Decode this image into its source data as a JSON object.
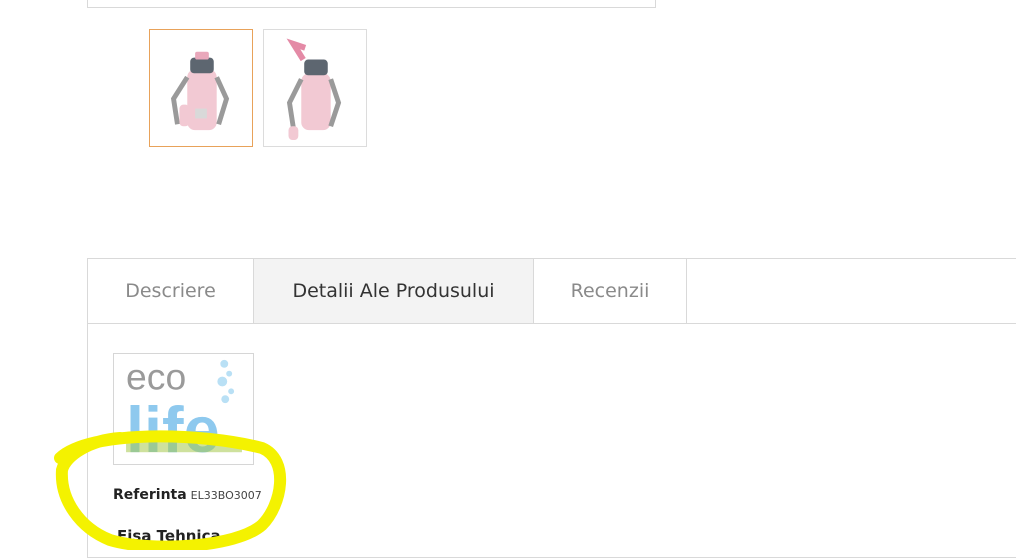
{
  "gallery": {
    "thumbnails": [
      {
        "alt": "pink water bottle front",
        "active": true
      },
      {
        "alt": "pink water bottle side",
        "active": false
      }
    ]
  },
  "tabs": {
    "items": [
      {
        "label": "Descriere",
        "active": false
      },
      {
        "label": "Detalii Ale Produsului",
        "active": true
      },
      {
        "label": "Recenzii",
        "active": false
      }
    ]
  },
  "details": {
    "brand_logo": {
      "text_top": "eco",
      "text_bottom": "life"
    },
    "reference_label": "Referinta",
    "reference_value": "EL33BO3007",
    "datasheet_label": "Fisa Tehnica"
  },
  "colors": {
    "active_thumb_border": "#e8a25a",
    "highlight": "#f4f200",
    "logo_blue": "#8ec9ee",
    "logo_green": "#a5c94d"
  }
}
